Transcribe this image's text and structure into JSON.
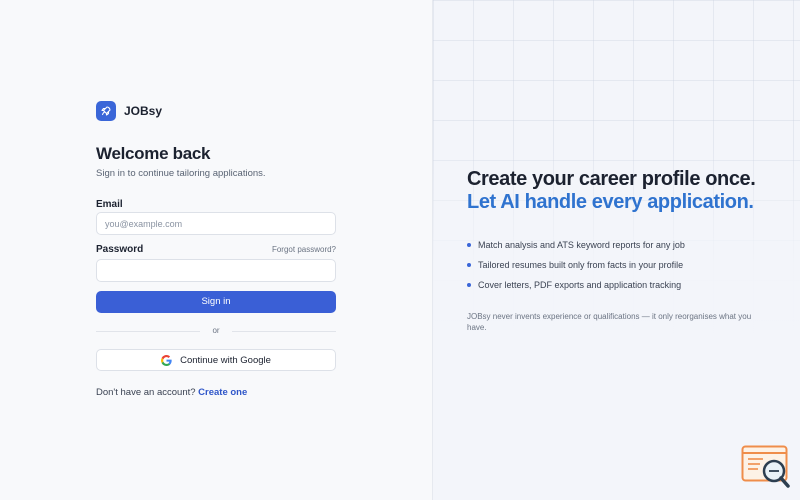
{
  "brand": {
    "name": "JOBsy",
    "logo_icon": "rocket-icon",
    "accent": "#3a66d8"
  },
  "login": {
    "title": "Welcome back",
    "subtitle": "Sign in to continue tailoring applications.",
    "email_label": "Email",
    "email_placeholder": "you@example.com",
    "email_value": "",
    "password_label": "Password",
    "password_value": "",
    "forgot_password": "Forgot password?",
    "sign_in_button": "Sign in",
    "divider_text": "or",
    "google_button": "Continue with Google",
    "no_account_text": "Don't have an account?",
    "create_account_link": "Create one"
  },
  "promo": {
    "headline": "Create your career profile once.",
    "headline_accent": "Let AI handle every application.",
    "features": [
      "Match analysis and ATS keyword reports for any job",
      "Tailored resumes built only from facts in your profile",
      "Cover letters, PDF exports and application tracking"
    ],
    "disclaimer": "JOBsy never invents experience or qualifications — it only reorganises what you have."
  },
  "colors": {
    "primary_button": "#3a5fd6",
    "headline_accent": "#2f73cf",
    "link": "#2f56c9"
  }
}
